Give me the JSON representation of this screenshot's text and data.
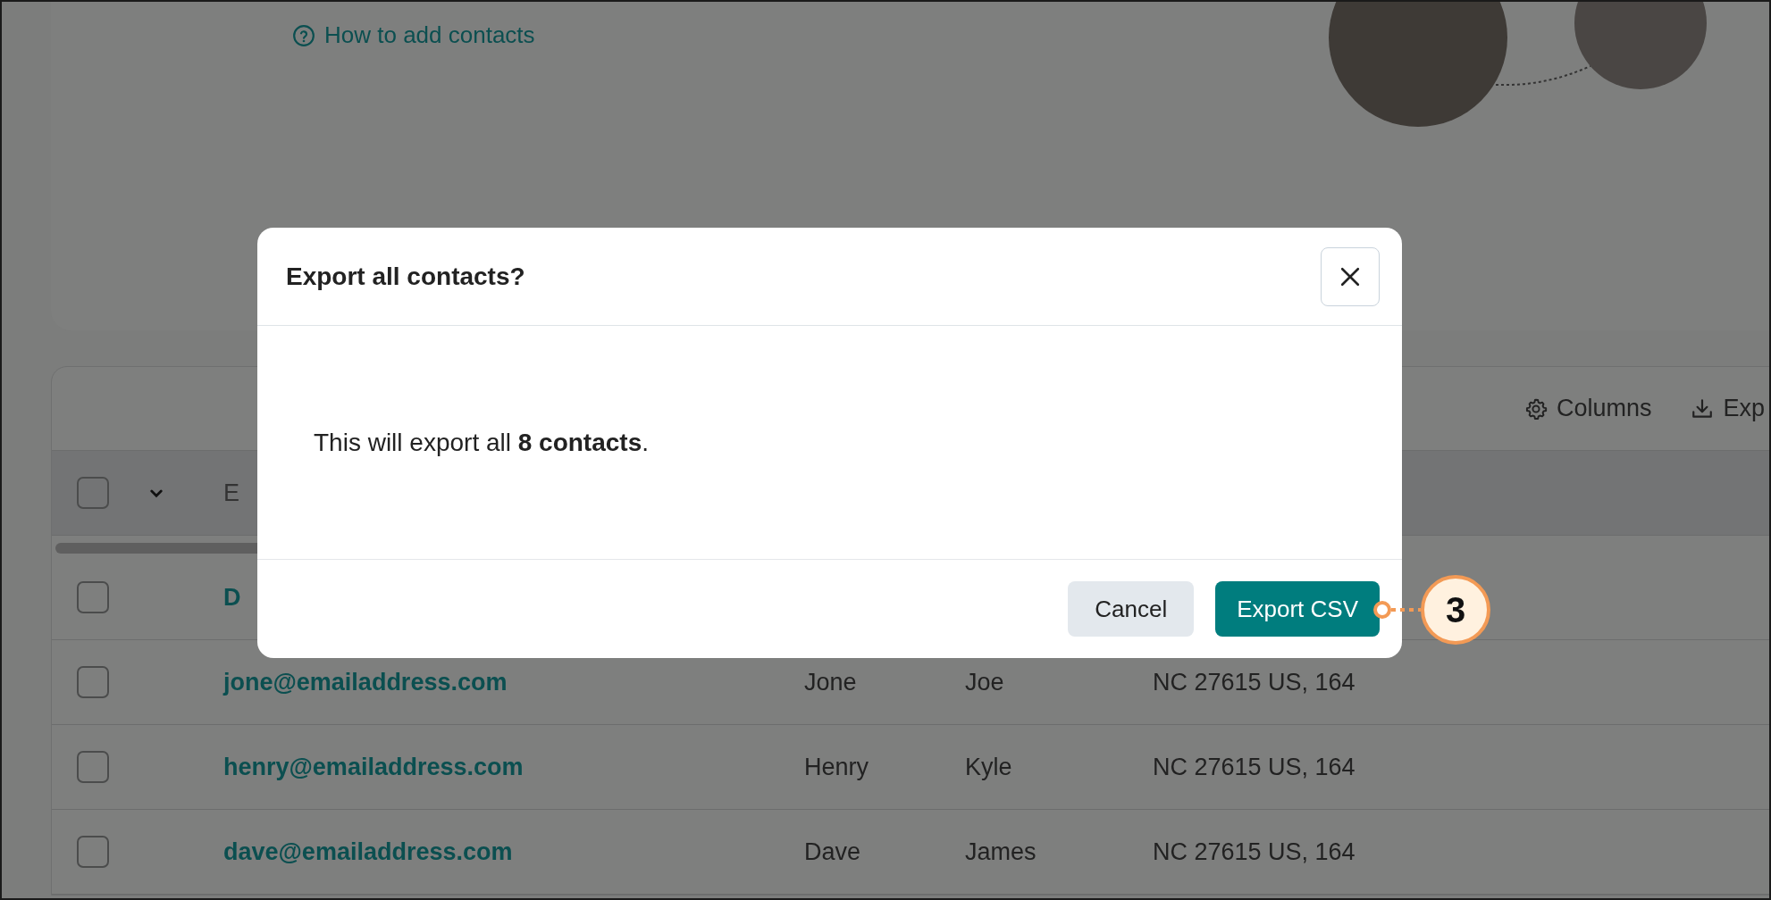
{
  "help_link": {
    "label": "How to add contacts"
  },
  "toolbar": {
    "actions": [
      {
        "label": "Columns",
        "kind": "gear"
      },
      {
        "label": "Exp",
        "kind": "download"
      }
    ]
  },
  "table": {
    "select_all": {
      "checked": false
    },
    "columns": [
      "E"
    ],
    "rows": [
      {
        "checked": false,
        "cells": [
          "D"
        ]
      },
      {
        "checked": false,
        "cells": [
          "jone@emailaddress.com",
          "Jone",
          "Joe",
          "NC 27615 US, 164"
        ]
      },
      {
        "checked": false,
        "cells": [
          "henry@emailaddress.com",
          "Henry",
          "Kyle",
          "NC 27615 US, 164"
        ]
      },
      {
        "checked": false,
        "cells": [
          "dave@emailaddress.com",
          "Dave",
          "James",
          "NC 27615 US, 164"
        ]
      }
    ]
  },
  "dialog": {
    "title": "Export all contacts?",
    "message": "This will export all **8 contacts**.",
    "buttons": [
      {
        "label": "Cancel",
        "kind": "secondary"
      },
      {
        "label": "Export CSV",
        "kind": "primary"
      }
    ]
  },
  "callout": {
    "label": "3"
  }
}
